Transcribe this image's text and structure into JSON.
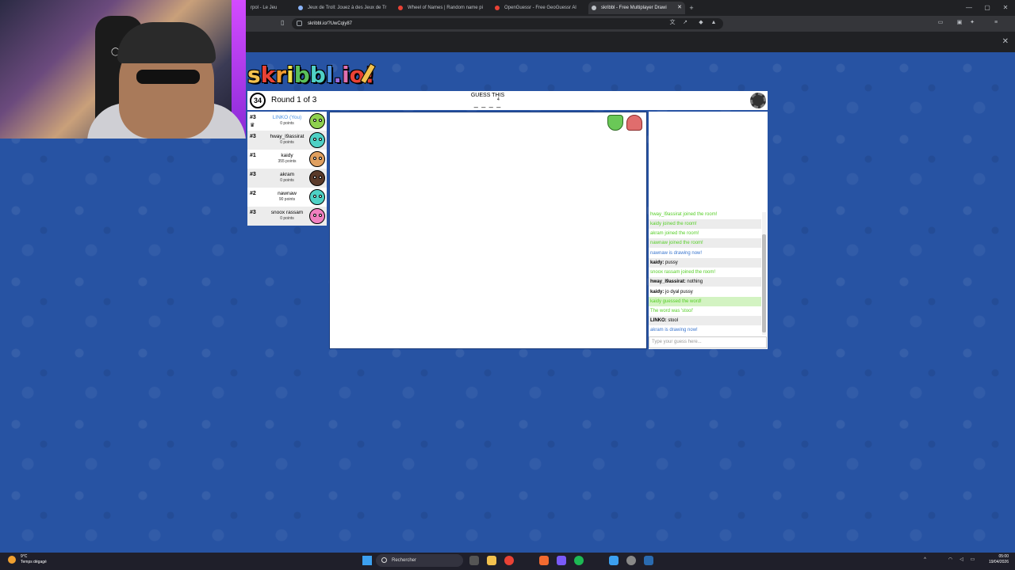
{
  "browser": {
    "tabs": [
      {
        "label": "rpol - Le Jeu",
        "active": false
      },
      {
        "label": "Jeux de Troll: Jouez à des Jeux de Tr",
        "active": false
      },
      {
        "label": "Wheel of Names | Random name pi",
        "active": false
      },
      {
        "label": "OpenGuessr - Free GeoGuessr Al",
        "active": false
      },
      {
        "label": "skribbl - Free Multiplayer Drawi",
        "active": true
      }
    ],
    "new_tab": "+",
    "url": "skribbl.io/?UwCqiy87",
    "window_controls": [
      "—",
      "▢",
      "✕"
    ]
  },
  "game": {
    "logo": "skribbl.io",
    "timer": "34",
    "round": "Round 1 of 3",
    "guess_label": "GUESS THIS",
    "word_blanks": "_ _ _ _",
    "word_length": "4",
    "players": [
      {
        "rank": "#3",
        "name": "LINKO (You)",
        "points": "0 points",
        "you": true,
        "avatar_color": "#8fd14f"
      },
      {
        "rank": "#3",
        "name": "hway_l9assirat",
        "points": "0 points",
        "you": false,
        "avatar_color": "#4fd1c5"
      },
      {
        "rank": "#1",
        "name": "kaidy",
        "points": "355 points",
        "you": false,
        "avatar_color": "#e0a060"
      },
      {
        "rank": "#3",
        "name": "akram",
        "points": "0 points",
        "you": false,
        "avatar_color": "#5a3a2a"
      },
      {
        "rank": "#2",
        "name": "nawnaw",
        "points": "90 points",
        "you": false,
        "avatar_color": "#4fd1c5"
      },
      {
        "rank": "#3",
        "name": "snoox rassam",
        "points": "0 points",
        "you": false,
        "avatar_color": "#f080c0"
      }
    ],
    "chat": [
      {
        "text": "hway_l9assirat joined the room!",
        "style": "green"
      },
      {
        "text": "kaidy joined the room!",
        "style": "green"
      },
      {
        "text": "akram joined the room!",
        "style": "green"
      },
      {
        "text": "nawnaw joined the room!",
        "style": "green"
      },
      {
        "text": "nawnaw is drawing now!",
        "style": "blue"
      },
      {
        "author": "kaidy:",
        "text": "pussy",
        "style": "black"
      },
      {
        "text": "snoox rassam joined the room!",
        "style": "green"
      },
      {
        "author": "hway_l9assirat:",
        "text": "nothing",
        "style": "black"
      },
      {
        "author": "kaidy:",
        "text": "jo dyal pussy",
        "style": "black"
      },
      {
        "text": "kaidy guessed the word!",
        "style": "green-hl"
      },
      {
        "text": "The word was 'stool'",
        "style": "green"
      },
      {
        "author": "LINKO:",
        "text": "stool",
        "style": "black"
      },
      {
        "text": "akram is drawing now!",
        "style": "blue"
      }
    ],
    "guess_placeholder": "Type your guess here..."
  },
  "taskbar": {
    "temp": "9°C",
    "weather": "Temps dégagé",
    "search": "Rechercher",
    "time": "05:00",
    "date": "19/04/2026"
  }
}
